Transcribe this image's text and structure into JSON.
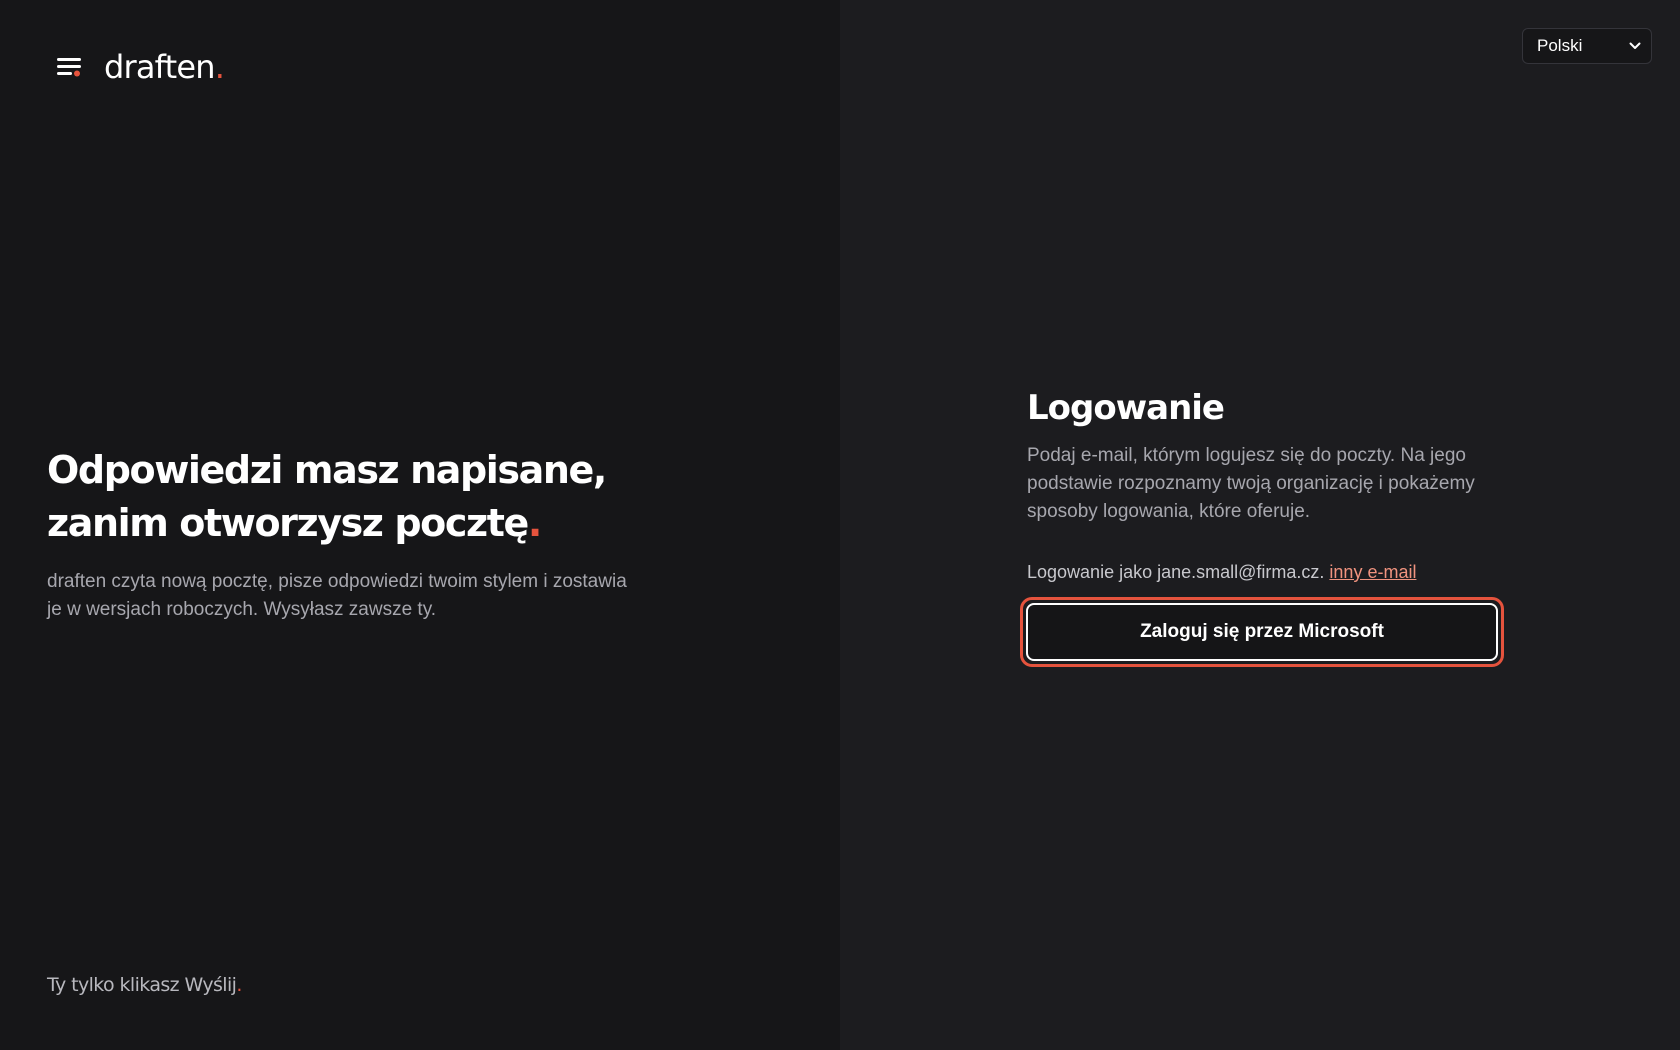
{
  "brand": {
    "name": "draften",
    "dot": ".",
    "icon": "menu-lines-icon",
    "accent": "#e5533d"
  },
  "hero": {
    "title_line1": "Odpowiedzi masz napisane,",
    "title_line2": "zanim otworzysz pocztę",
    "title_dot": ".",
    "subtitle": "draften czyta nową pocztę, pisze odpowiedzi twoim stylem i zostawia je w wersjach roboczych. Wysyłasz zawsze ty."
  },
  "tagline": {
    "text": "Ty tylko klikasz Wyślij",
    "dot": "."
  },
  "language": {
    "selected": "Polski",
    "icon": "chevron-down-icon"
  },
  "login": {
    "title": "Logowanie",
    "description": "Podaj e-mail, którym logujesz się do poczty. Na jego podstawie rozpoznamy twoją organizację i pokażemy sposoby logowania, które oferuje.",
    "logged_as_prefix": "Logowanie jako jane.small@firma.cz.",
    "other_email_link": "inny e-mail",
    "microsoft_button": "Zaloguj się przez Microsoft"
  }
}
